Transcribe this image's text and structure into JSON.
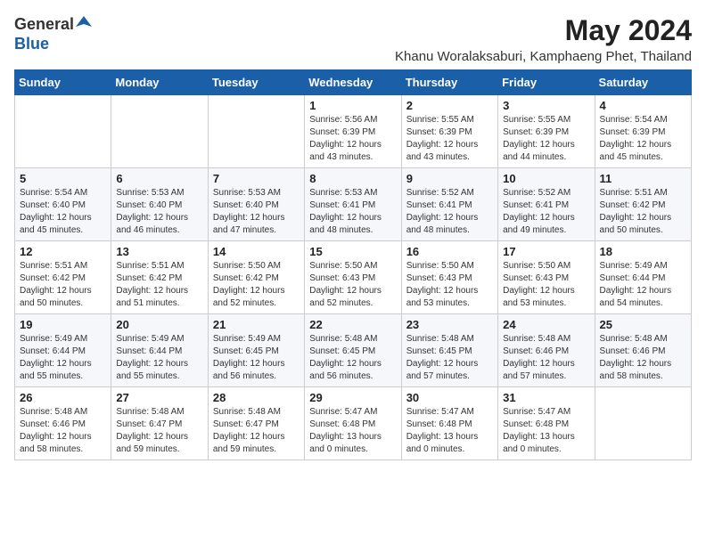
{
  "logo": {
    "general": "General",
    "blue": "Blue"
  },
  "title": "May 2024",
  "subtitle": "Khanu Woralaksaburi, Kamphaeng Phet, Thailand",
  "weekdays": [
    "Sunday",
    "Monday",
    "Tuesday",
    "Wednesday",
    "Thursday",
    "Friday",
    "Saturday"
  ],
  "weeks": [
    [
      {
        "day": "",
        "info": ""
      },
      {
        "day": "",
        "info": ""
      },
      {
        "day": "",
        "info": ""
      },
      {
        "day": "1",
        "info": "Sunrise: 5:56 AM\nSunset: 6:39 PM\nDaylight: 12 hours\nand 43 minutes."
      },
      {
        "day": "2",
        "info": "Sunrise: 5:55 AM\nSunset: 6:39 PM\nDaylight: 12 hours\nand 43 minutes."
      },
      {
        "day": "3",
        "info": "Sunrise: 5:55 AM\nSunset: 6:39 PM\nDaylight: 12 hours\nand 44 minutes."
      },
      {
        "day": "4",
        "info": "Sunrise: 5:54 AM\nSunset: 6:39 PM\nDaylight: 12 hours\nand 45 minutes."
      }
    ],
    [
      {
        "day": "5",
        "info": "Sunrise: 5:54 AM\nSunset: 6:40 PM\nDaylight: 12 hours\nand 45 minutes."
      },
      {
        "day": "6",
        "info": "Sunrise: 5:53 AM\nSunset: 6:40 PM\nDaylight: 12 hours\nand 46 minutes."
      },
      {
        "day": "7",
        "info": "Sunrise: 5:53 AM\nSunset: 6:40 PM\nDaylight: 12 hours\nand 47 minutes."
      },
      {
        "day": "8",
        "info": "Sunrise: 5:53 AM\nSunset: 6:41 PM\nDaylight: 12 hours\nand 48 minutes."
      },
      {
        "day": "9",
        "info": "Sunrise: 5:52 AM\nSunset: 6:41 PM\nDaylight: 12 hours\nand 48 minutes."
      },
      {
        "day": "10",
        "info": "Sunrise: 5:52 AM\nSunset: 6:41 PM\nDaylight: 12 hours\nand 49 minutes."
      },
      {
        "day": "11",
        "info": "Sunrise: 5:51 AM\nSunset: 6:42 PM\nDaylight: 12 hours\nand 50 minutes."
      }
    ],
    [
      {
        "day": "12",
        "info": "Sunrise: 5:51 AM\nSunset: 6:42 PM\nDaylight: 12 hours\nand 50 minutes."
      },
      {
        "day": "13",
        "info": "Sunrise: 5:51 AM\nSunset: 6:42 PM\nDaylight: 12 hours\nand 51 minutes."
      },
      {
        "day": "14",
        "info": "Sunrise: 5:50 AM\nSunset: 6:42 PM\nDaylight: 12 hours\nand 52 minutes."
      },
      {
        "day": "15",
        "info": "Sunrise: 5:50 AM\nSunset: 6:43 PM\nDaylight: 12 hours\nand 52 minutes."
      },
      {
        "day": "16",
        "info": "Sunrise: 5:50 AM\nSunset: 6:43 PM\nDaylight: 12 hours\nand 53 minutes."
      },
      {
        "day": "17",
        "info": "Sunrise: 5:50 AM\nSunset: 6:43 PM\nDaylight: 12 hours\nand 53 minutes."
      },
      {
        "day": "18",
        "info": "Sunrise: 5:49 AM\nSunset: 6:44 PM\nDaylight: 12 hours\nand 54 minutes."
      }
    ],
    [
      {
        "day": "19",
        "info": "Sunrise: 5:49 AM\nSunset: 6:44 PM\nDaylight: 12 hours\nand 55 minutes."
      },
      {
        "day": "20",
        "info": "Sunrise: 5:49 AM\nSunset: 6:44 PM\nDaylight: 12 hours\nand 55 minutes."
      },
      {
        "day": "21",
        "info": "Sunrise: 5:49 AM\nSunset: 6:45 PM\nDaylight: 12 hours\nand 56 minutes."
      },
      {
        "day": "22",
        "info": "Sunrise: 5:48 AM\nSunset: 6:45 PM\nDaylight: 12 hours\nand 56 minutes."
      },
      {
        "day": "23",
        "info": "Sunrise: 5:48 AM\nSunset: 6:45 PM\nDaylight: 12 hours\nand 57 minutes."
      },
      {
        "day": "24",
        "info": "Sunrise: 5:48 AM\nSunset: 6:46 PM\nDaylight: 12 hours\nand 57 minutes."
      },
      {
        "day": "25",
        "info": "Sunrise: 5:48 AM\nSunset: 6:46 PM\nDaylight: 12 hours\nand 58 minutes."
      }
    ],
    [
      {
        "day": "26",
        "info": "Sunrise: 5:48 AM\nSunset: 6:46 PM\nDaylight: 12 hours\nand 58 minutes."
      },
      {
        "day": "27",
        "info": "Sunrise: 5:48 AM\nSunset: 6:47 PM\nDaylight: 12 hours\nand 59 minutes."
      },
      {
        "day": "28",
        "info": "Sunrise: 5:48 AM\nSunset: 6:47 PM\nDaylight: 12 hours\nand 59 minutes."
      },
      {
        "day": "29",
        "info": "Sunrise: 5:47 AM\nSunset: 6:48 PM\nDaylight: 13 hours\nand 0 minutes."
      },
      {
        "day": "30",
        "info": "Sunrise: 5:47 AM\nSunset: 6:48 PM\nDaylight: 13 hours\nand 0 minutes."
      },
      {
        "day": "31",
        "info": "Sunrise: 5:47 AM\nSunset: 6:48 PM\nDaylight: 13 hours\nand 0 minutes."
      },
      {
        "day": "",
        "info": ""
      }
    ]
  ]
}
